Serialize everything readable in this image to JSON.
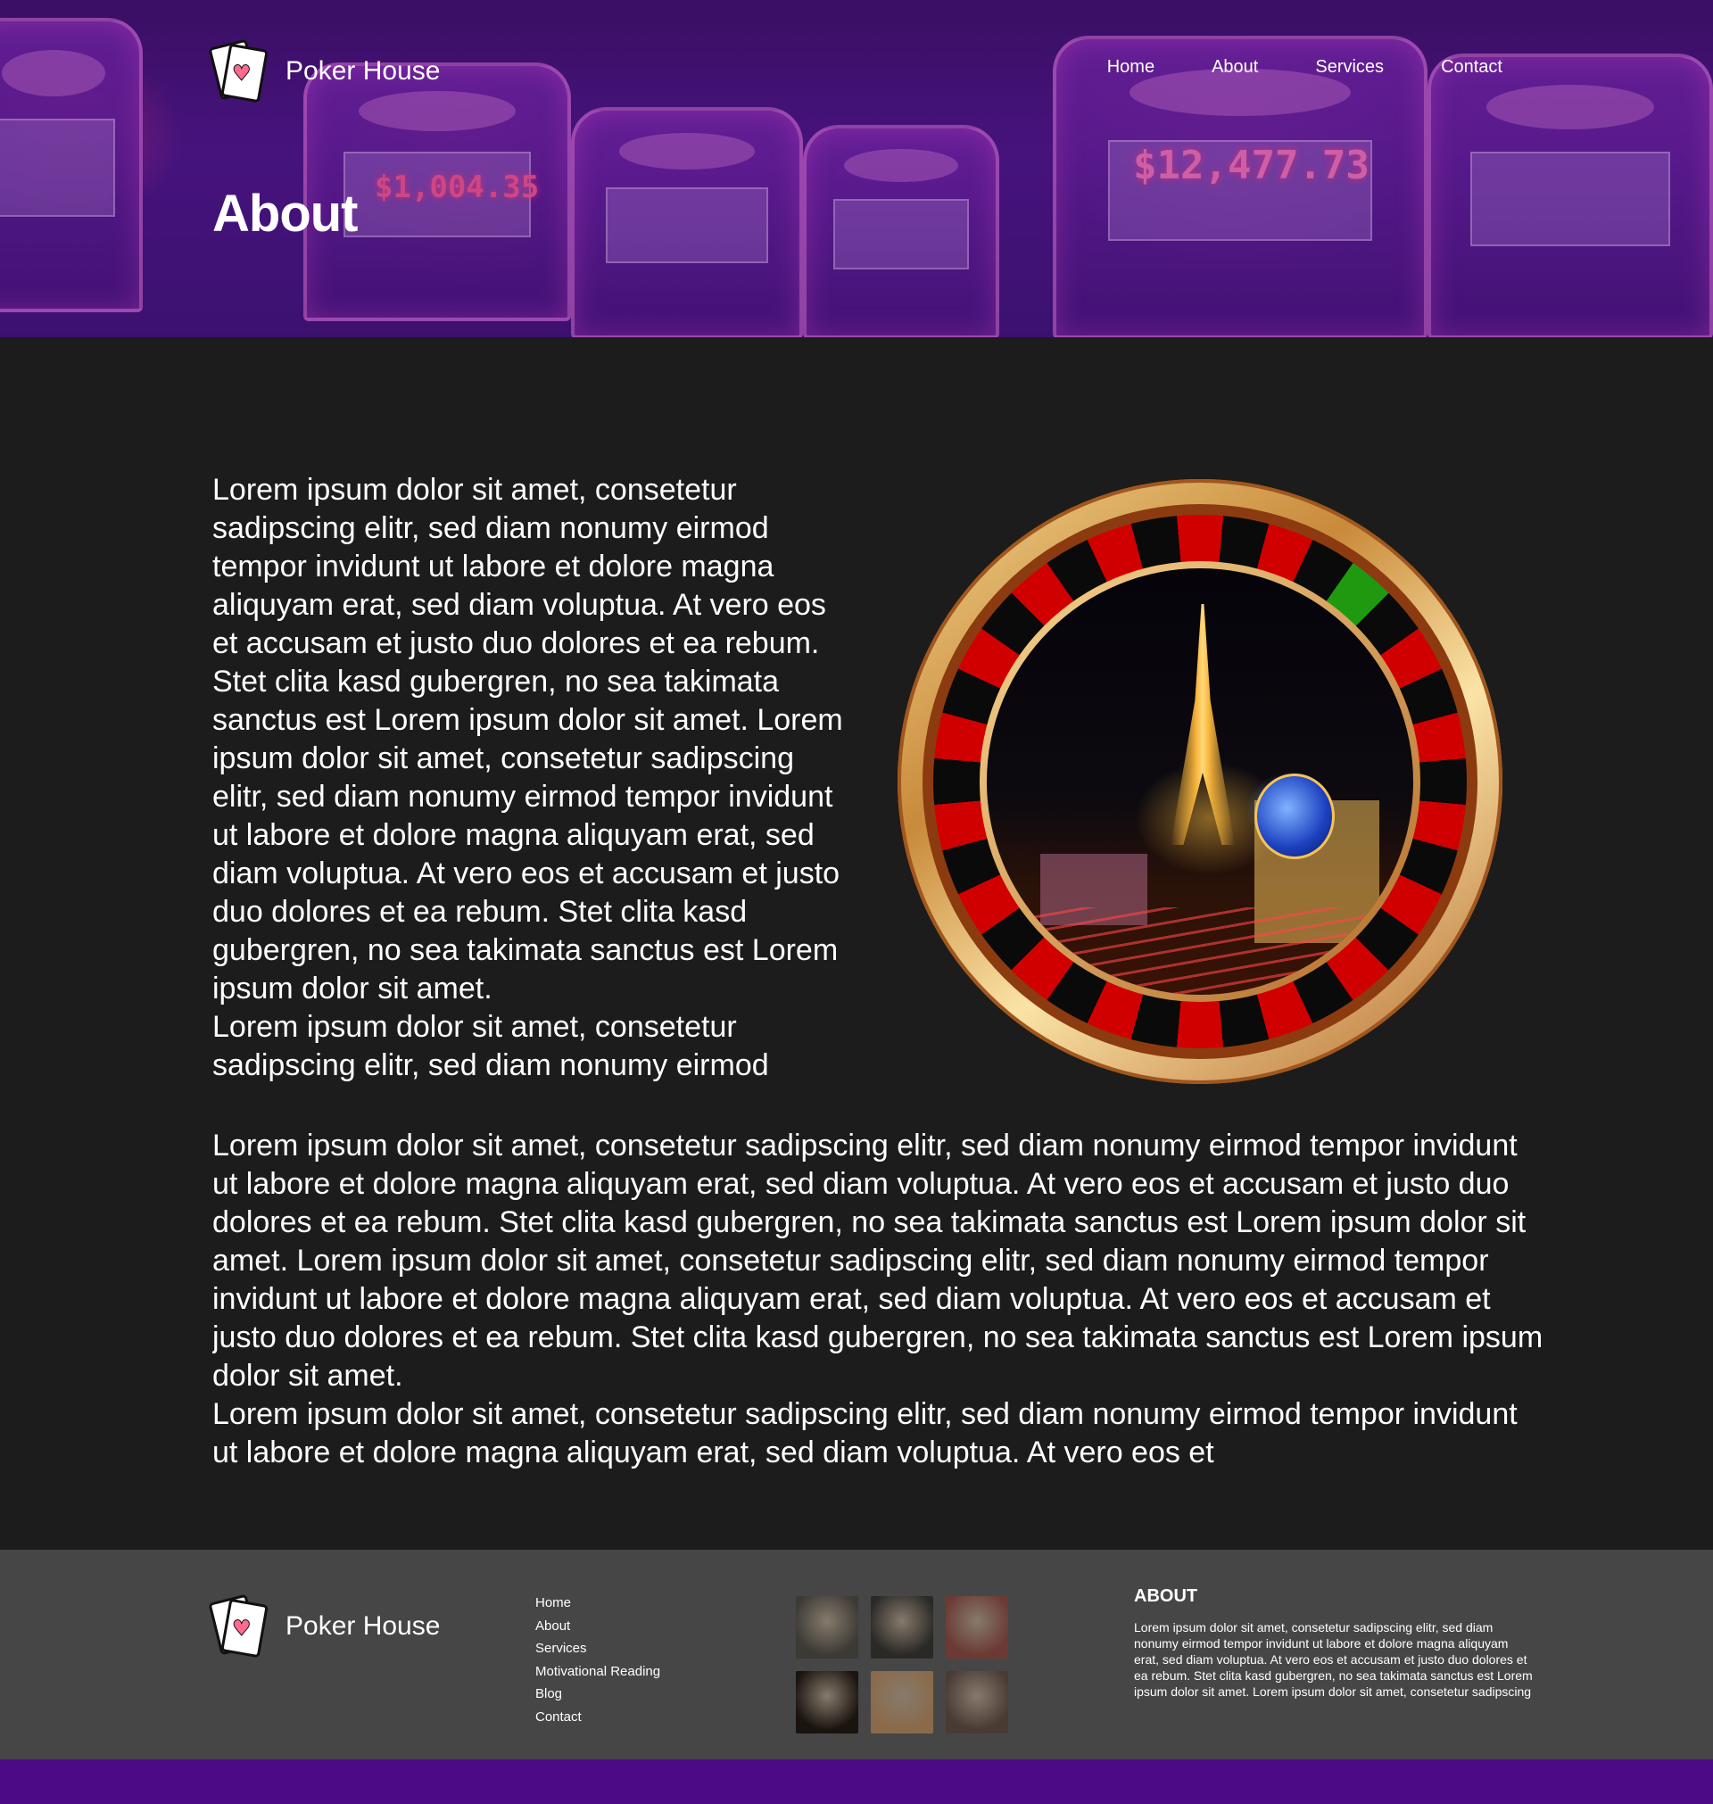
{
  "brand": {
    "name": "Poker House",
    "logo_icon": "playing-cards-heart-icon",
    "heart_glyph": "♥"
  },
  "nav": {
    "items": [
      "Home",
      "About",
      "Services",
      "Contact"
    ]
  },
  "hero": {
    "title": "About"
  },
  "about": {
    "column_paragraphs": [
      "Lorem ipsum dolor sit amet, consetetur sadipscing elitr, sed diam nonumy eirmod tempor invidunt ut labore et dolore magna aliquyam erat, sed diam voluptua. At vero eos et accusam et justo duo dolores et ea rebum. Stet clita kasd gubergren, no sea takimata sanctus est Lorem ipsum dolor sit amet. Lorem ipsum dolor sit amet, consetetur sadipscing elitr, sed diam nonumy eirmod tempor invidunt ut labore et dolore magna aliquyam erat, sed diam voluptua. At vero eos et accusam et justo duo dolores et ea rebum. Stet clita kasd gubergren, no sea takimata sanctus est Lorem ipsum dolor sit amet.",
      "Lorem ipsum dolor sit amet, consetetur sadipscing elitr, sed diam nonumy eirmod"
    ],
    "full_paragraphs": [
      "Lorem ipsum dolor sit amet, consetetur sadipscing elitr, sed diam nonumy eirmod tempor invidunt ut labore et dolore magna aliquyam erat, sed diam voluptua. At vero eos et accusam et justo duo dolores et ea rebum. Stet clita kasd gubergren, no sea takimata sanctus est Lorem ipsum dolor sit amet. Lorem ipsum dolor sit amet, consetetur sadipscing elitr, sed diam nonumy eirmod tempor invidunt ut labore et dolore magna aliquyam erat, sed diam voluptua. At vero eos et accusam et justo duo dolores et ea rebum. Stet clita kasd gubergren, no sea takimata sanctus est Lorem ipsum dolor sit amet.",
      "Lorem ipsum dolor sit amet, consetetur sadipscing elitr, sed diam nonumy eirmod tempor invidunt ut labore et dolore magna aliquyam erat, sed diam voluptua. At vero eos et"
    ]
  },
  "footer": {
    "links": [
      "Home",
      "About",
      "Services",
      "Motivational Reading",
      "Blog",
      "Contact"
    ],
    "gallery_colors": [
      "#3c3a34",
      "#2a2926",
      "#6b3a34",
      "#1a140e",
      "#8a6a4a",
      "#4a3a34"
    ],
    "about_title": "ABOUT",
    "about_text": "Lorem ipsum dolor sit amet, consetetur sadipscing elitr, sed diam nonumy eirmod tempor invidunt ut labore et dolore magna aliquyam erat, sed diam voluptua. At vero eos et accusam et justo duo dolores et ea rebum. Stet clita kasd gubergren, no sea takimata sanctus est Lorem ipsum dolor sit amet. Lorem ipsum dolor sit amet, consetetur sadipscing elitr, sed diam nonumy eirmod tempor invidunt ut labore et dolore magna aliquyam erat,"
  },
  "colors": {
    "accent_purple": "#4b0b86",
    "page_bg": "#1c1c1c",
    "footer_bg": "#464646"
  }
}
